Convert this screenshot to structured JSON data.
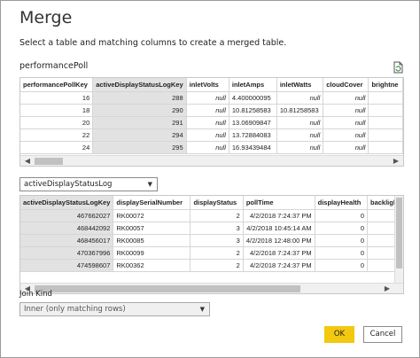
{
  "dialog": {
    "title": "Merge",
    "subtitle": "Select a table and matching columns to create a merged table."
  },
  "table1": {
    "name": "performancePoll",
    "icon": "refresh-preview-icon",
    "columns": [
      "performancePollKey",
      "activeDisplayStatusLogKey",
      "inletVolts",
      "inletAmps",
      "inletWatts",
      "cloudCover",
      "brightne"
    ],
    "rows": [
      [
        "16",
        "288",
        "null",
        "4.400000095",
        "null",
        "null",
        ""
      ],
      [
        "18",
        "290",
        "null",
        "10.81258583",
        "10.81258583",
        "null",
        ""
      ],
      [
        "20",
        "291",
        "null",
        "13.06909847",
        "null",
        "null",
        ""
      ],
      [
        "22",
        "294",
        "null",
        "13.72884083",
        "null",
        "null",
        ""
      ],
      [
        "24",
        "295",
        "null",
        "16.93439484",
        "null",
        "null",
        ""
      ]
    ]
  },
  "table2": {
    "selected_table": "activeDisplayStatusLog",
    "columns": [
      "activeDisplayStatusLogKey",
      "displaySerialNumber",
      "displayStatus",
      "pollTime",
      "displayHealth",
      "backlight"
    ],
    "rows": [
      [
        "467662027",
        "RK00072",
        "2",
        "4/2/2018 7:24:37 PM",
        "0",
        ""
      ],
      [
        "468442092",
        "RK00057",
        "3",
        "4/2/2018 10:45:14 AM",
        "0",
        ""
      ],
      [
        "468456017",
        "RK00085",
        "3",
        "4/2/2018 12:48:00 PM",
        "0",
        ""
      ],
      [
        "470367996",
        "RK00099",
        "2",
        "4/2/2018 7:24:37 PM",
        "0",
        ""
      ],
      [
        "474598607",
        "RK00362",
        "2",
        "4/2/2018 7:24:37 PM",
        "0",
        ""
      ]
    ]
  },
  "join": {
    "label": "Join Kind",
    "selected": "Inner (only matching rows)"
  },
  "buttons": {
    "ok": "OK",
    "cancel": "Cancel"
  },
  "colors": {
    "accent": "#f2c811",
    "selected_column": "#e2e2e2"
  }
}
